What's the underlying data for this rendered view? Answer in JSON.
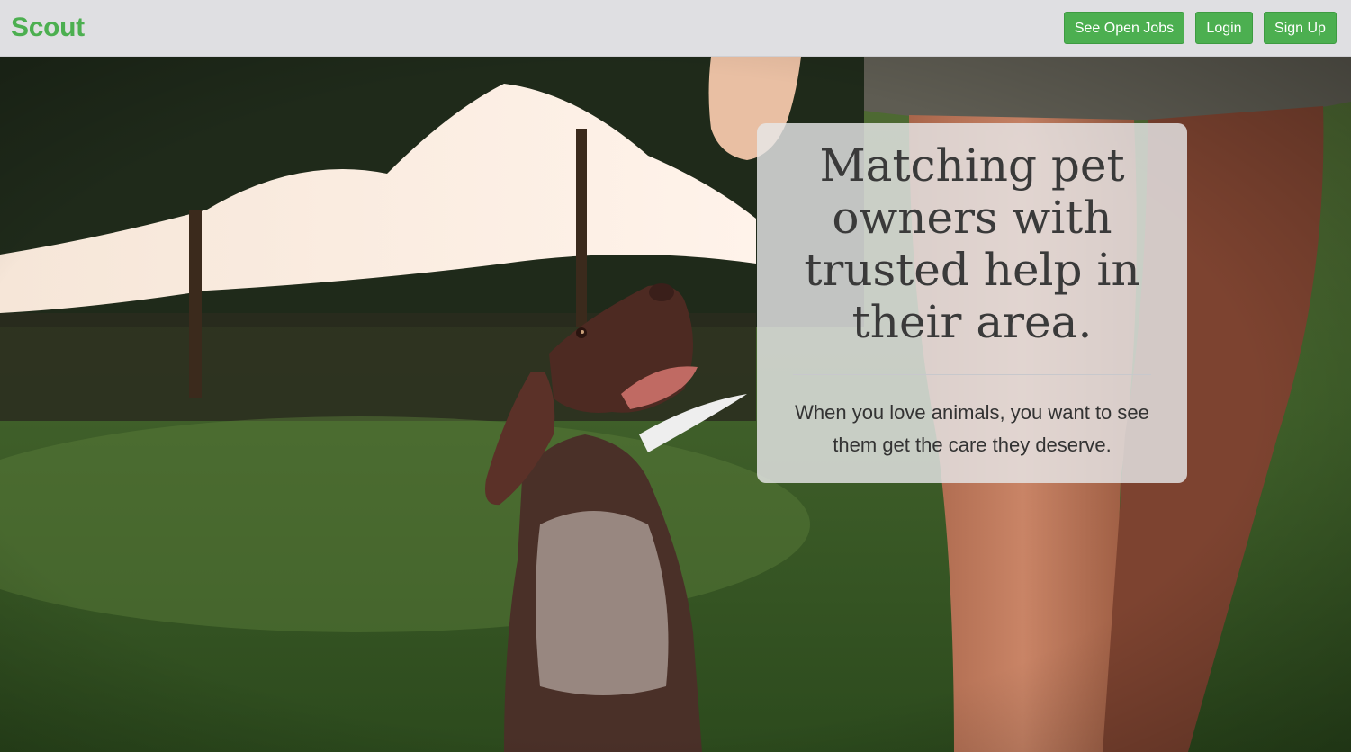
{
  "navbar": {
    "brand": "Scout",
    "buttons": {
      "open_jobs": "See Open Jobs",
      "login": "Login",
      "signup": "Sign Up"
    }
  },
  "hero": {
    "headline": "Matching pet owners with trusted help in their area.",
    "subtext": "When you love animals, you want to see them get the care they deserve.",
    "background_description_icon": "photo-dog-and-owner"
  },
  "colors": {
    "brand_green": "#4caf50",
    "navbar_bg": "#dfdfe2"
  }
}
